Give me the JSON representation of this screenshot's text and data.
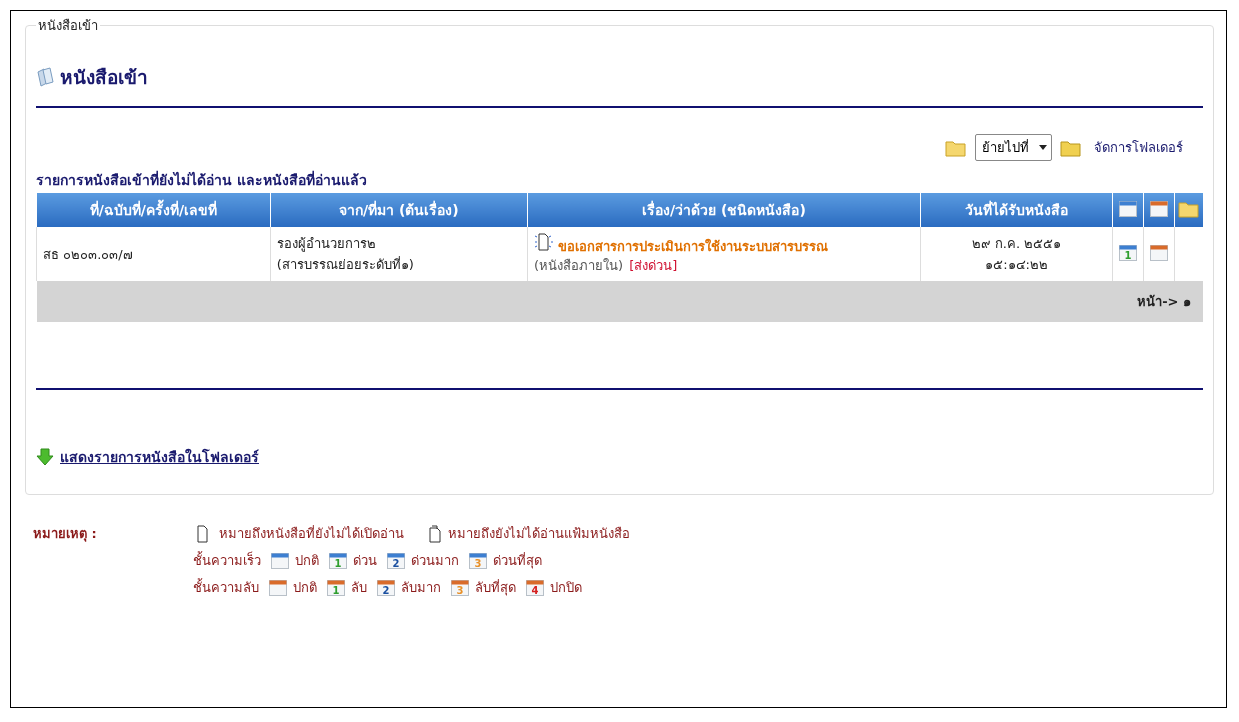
{
  "panel": {
    "legend": "หนังสือเข้า",
    "title": "หนังสือเข้า"
  },
  "toolbar": {
    "move_select": "ย้ายไปที่",
    "manage_folders": "จัดการโฟลเดอร์"
  },
  "caption": "รายการหนังสือเข้าที่ยังไม่ได้อ่าน และหนังสือที่อ่านแล้ว",
  "table": {
    "columns": [
      "ที่/ฉบับที่/ครั้งที่/เลขที่",
      "จาก/ที่มา (ต้นเรื่อง)",
      "เรื่อง/ว่าด้วย (ชนิดหนังสือ)",
      "วันที่ได้รับหนังสือ"
    ],
    "rows": [
      {
        "number": "สธ ๐๒๐๓.๐๓/๗",
        "from": "รองผู้อำนวยการ๒",
        "from_detail": "(สารบรรณย่อยระดับที่๑)",
        "unread": true,
        "subject": "ขอเอกสารการประเมินการใช้งานระบบสารบรรณ",
        "type": "(หนังสือภายใน)",
        "urgency": "[ส่งด่วน]",
        "date": "๒๙ ก.ค. ๒๕๕๑",
        "time": "๑๕:๑๔:๒๒",
        "speed": {
          "number": "1",
          "color": "#2e9e2e"
        },
        "secrecy": {}
      }
    ],
    "pager": "หน้า-> ๑"
  },
  "folder_link": "แสดงรายการหนังสือในโฟลเดอร์",
  "notes": {
    "label": "หมายเหตุ :",
    "unread_doc": "หมายถึงหนังสือที่ยังไม่ได้เปิดอ่าน",
    "unread_folder": "หมายถึงยังไม่ได้อ่านแฟ้มหนังสือ",
    "rows": [
      {
        "kind": "speed",
        "label": "ชั้นความเร็ว",
        "items": [
          {
            "label": "ปกติ"
          },
          {
            "number": "1",
            "color": "#2e9e2e",
            "label": "ด่วน"
          },
          {
            "number": "2",
            "color": "#1a4fa0",
            "label": "ด่วนมาก"
          },
          {
            "number": "3",
            "color": "#e8912a",
            "label": "ด่วนที่สุด"
          }
        ]
      },
      {
        "kind": "secrecy",
        "label": "ชั้นความลับ",
        "items": [
          {
            "label": "ปกติ"
          },
          {
            "number": "1",
            "color": "#2e9e2e",
            "label": "ลับ"
          },
          {
            "number": "2",
            "color": "#1a4fa0",
            "label": "ลับมาก"
          },
          {
            "number": "3",
            "color": "#e8912a",
            "label": "ลับที่สุด"
          },
          {
            "number": "4",
            "color": "#d42020",
            "label": "ปกปิด"
          }
        ]
      }
    ]
  }
}
